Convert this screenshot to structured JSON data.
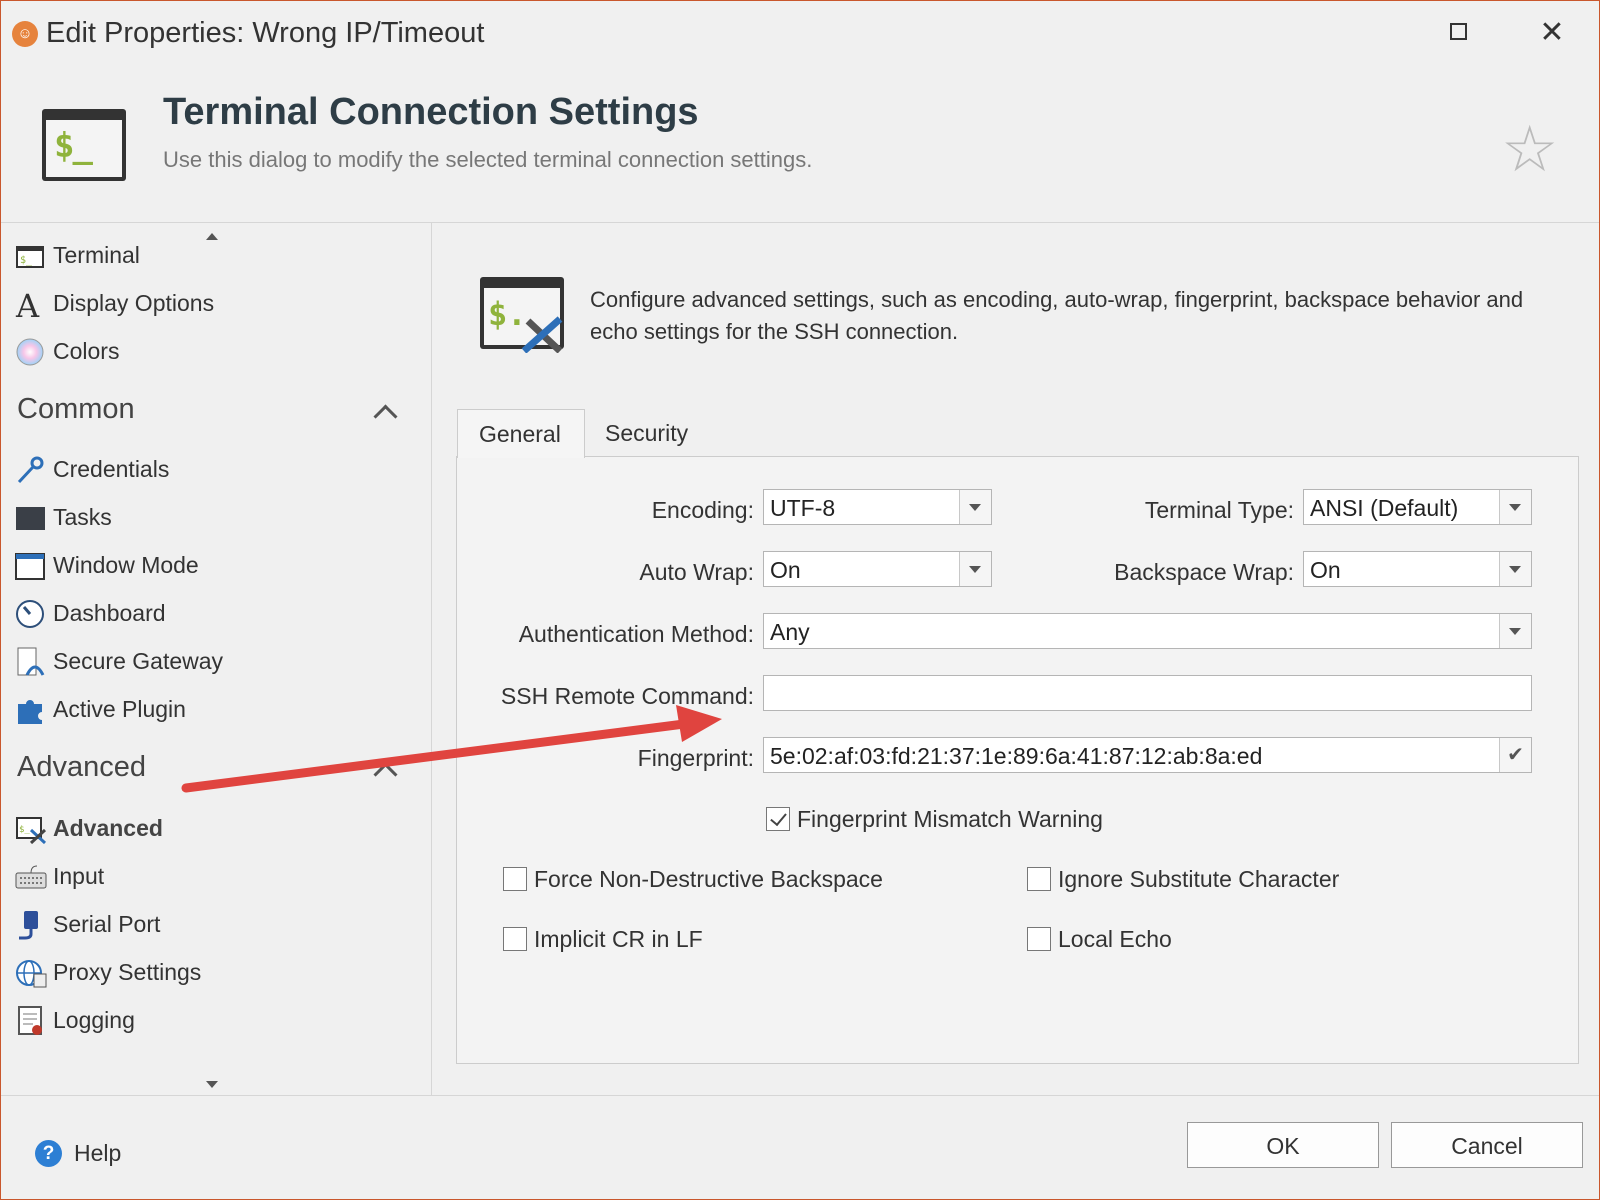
{
  "window": {
    "title": "Edit Properties: Wrong IP/Timeout",
    "close_glyph": "✕"
  },
  "header": {
    "title": "Terminal Connection Settings",
    "subtitle": "Use this dialog to modify the selected terminal connection settings.",
    "icon_text": "$_",
    "star_glyph": "☆"
  },
  "sidebar": {
    "top_items": [
      {
        "label": "Terminal",
        "icon": "terminal-icon"
      },
      {
        "label": "Display Options",
        "icon": "font-icon"
      },
      {
        "label": "Colors",
        "icon": "colors-icon"
      }
    ],
    "sections": [
      {
        "title": "Common",
        "items": [
          {
            "label": "Credentials",
            "icon": "key-icon"
          },
          {
            "label": "Tasks",
            "icon": "tasks-icon"
          },
          {
            "label": "Window Mode",
            "icon": "window-icon"
          },
          {
            "label": "Dashboard",
            "icon": "dashboard-icon"
          },
          {
            "label": "Secure Gateway",
            "icon": "gateway-icon"
          },
          {
            "label": "Active Plugin",
            "icon": "plugin-icon"
          }
        ]
      },
      {
        "title": "Advanced",
        "items": [
          {
            "label": "Advanced",
            "icon": "advanced-icon",
            "active": true
          },
          {
            "label": "Input",
            "icon": "keyboard-icon"
          },
          {
            "label": "Serial Port",
            "icon": "serial-port-icon"
          },
          {
            "label": "Proxy Settings",
            "icon": "globe-icon"
          },
          {
            "label": "Logging",
            "icon": "log-icon"
          }
        ]
      }
    ]
  },
  "main": {
    "description": "Configure advanced settings, such as encoding, auto-wrap, fingerprint, backspace behavior and echo settings for the SSH connection.",
    "tabs": [
      {
        "label": "General",
        "active": true
      },
      {
        "label": "Security",
        "active": false
      }
    ],
    "form": {
      "encoding": {
        "label": "Encoding:",
        "value": "UTF-8"
      },
      "terminal_type": {
        "label": "Terminal Type:",
        "value": "ANSI (Default)"
      },
      "auto_wrap": {
        "label": "Auto Wrap:",
        "value": "On"
      },
      "backspace_wrap": {
        "label": "Backspace Wrap:",
        "value": "On"
      },
      "auth_method": {
        "label": "Authentication Method:",
        "value": "Any"
      },
      "ssh_remote_command": {
        "label": "SSH Remote Command:",
        "value": ""
      },
      "fingerprint": {
        "label": "Fingerprint:",
        "value": "5e:02:af:03:fd:21:37:1e:89:6a:41:87:12:ab:8a:ed"
      }
    },
    "checkboxes": {
      "fingerprint_mismatch": {
        "label": "Fingerprint Mismatch Warning",
        "checked": true
      },
      "force_non_destructive_backspace": {
        "label": "Force Non-Destructive Backspace",
        "checked": false
      },
      "ignore_substitute_character": {
        "label": "Ignore Substitute Character",
        "checked": false
      },
      "implicit_cr_in_lf": {
        "label": "Implicit CR in LF",
        "checked": false
      },
      "local_echo": {
        "label": "Local Echo",
        "checked": false
      }
    }
  },
  "footer": {
    "help_label": "Help",
    "help_glyph": "?",
    "ok_label": "OK",
    "cancel_label": "Cancel"
  },
  "colors": {
    "window_border": "#c9572d",
    "annotation_arrow": "#e0443f",
    "prompt_green": "#8fb33c",
    "help_blue": "#2d7fd4"
  }
}
